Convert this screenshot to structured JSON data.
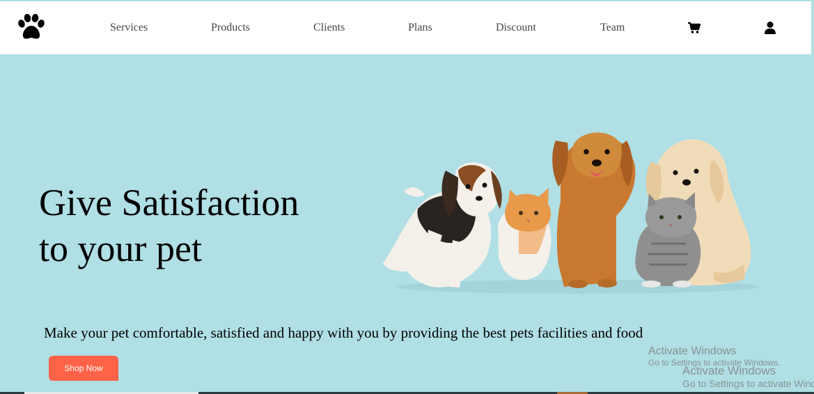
{
  "nav": {
    "links": [
      "Services",
      "Products",
      "Clients",
      "Plans",
      "Discount",
      "Team"
    ],
    "logo_icon": "paw-icon",
    "cart_icon": "cart-icon",
    "user_icon": "user-icon"
  },
  "hero": {
    "title_line1": "Give Satisfaction",
    "title_line2": "to your pet",
    "tagline": "Make your pet comfortable, satisfied and happy with you by providing the best pets facilities and food",
    "cta_label": "Shop Now"
  },
  "watermark": {
    "title": "Activate Windows",
    "subtitle": "Go to Settings to activate Windows."
  },
  "colors": {
    "background": "#b0dfe5",
    "navbar": "#ffffff",
    "cta": "#ff6347"
  }
}
